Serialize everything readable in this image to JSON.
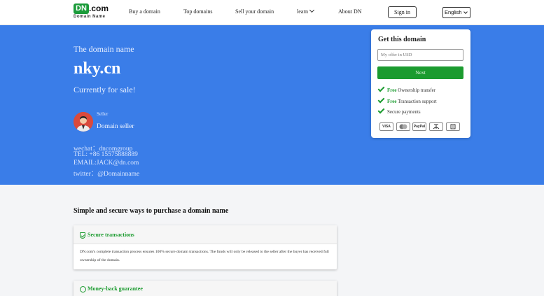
{
  "header": {
    "logo_badge": "DN",
    "logo_com": ".com",
    "logo_sub": "Domain Name",
    "nav": [
      "Buy a domain",
      "Top domains",
      "Sell your domain",
      "learn",
      "About DN"
    ],
    "signin_label": "Sign in",
    "language": "English"
  },
  "hero": {
    "lead": "The domain name",
    "domain": "nky.cn",
    "status": "Currently for sale!",
    "seller_label": "Seller",
    "seller_name": "Domain seller",
    "contacts": [
      "wechat：dncomgroup",
      "TEL: +86 15575888889",
      "EMAIL:JACK@dn.com",
      "twitter：@Domainname"
    ]
  },
  "card": {
    "title": "Get this domain",
    "offer_placeholder": "My offer in USD",
    "next_label": "Next",
    "features": [
      {
        "free": "Free",
        "text": " Ownership transfer"
      },
      {
        "free": "Free",
        "text": " Transaction support"
      },
      {
        "free": "",
        "text": "Secure payments"
      }
    ],
    "payments": [
      "VISA",
      "MC",
      "PayPal",
      "ALI",
      "WX"
    ]
  },
  "lower": {
    "title": "Simple and secure ways to purchase a domain name",
    "box1_title": "Secure transactions",
    "box1_desc": "DN.com's complete transaction process ensures 100% secure domain transactions. The funds will only be released to the seller after the buyer has received full ownership of the domain.",
    "box2_title": "Money-back guarantee"
  },
  "colors": {
    "brand_green": "#1b9b2f",
    "hero_blue": "#3a7de8"
  }
}
